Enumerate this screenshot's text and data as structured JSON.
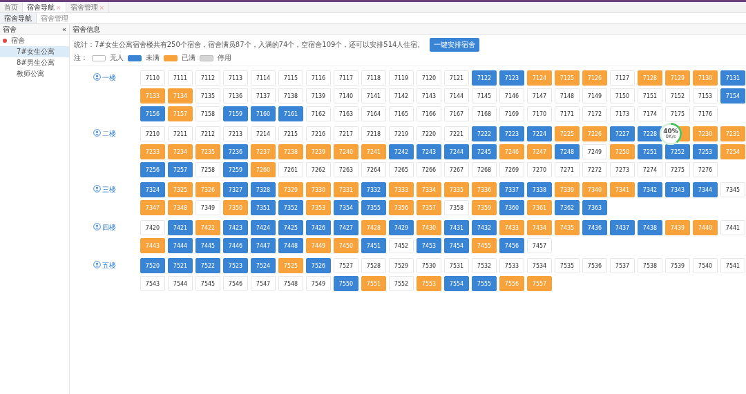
{
  "top_tabs": [
    {
      "label": "首页",
      "selected": false
    },
    {
      "label": "宿舍导航",
      "selected": true,
      "close": "×"
    },
    {
      "label": "宿舍管理",
      "selected": false,
      "close": "×"
    }
  ],
  "sub_tabs": [
    {
      "label": "宿舍导航",
      "selected": true
    },
    {
      "label": "宿舍管理",
      "selected": false
    }
  ],
  "sidebar": {
    "title": "宿舍",
    "collapse": "«",
    "tree": [
      {
        "label": "宿舍",
        "selected": false,
        "children": [
          {
            "label": "7#女生公寓",
            "selected": true
          },
          {
            "label": "8#男生公寓",
            "selected": false
          },
          {
            "label": "教师公寓",
            "selected": false
          }
        ]
      }
    ]
  },
  "main": {
    "title": "宿舍信息",
    "summary": "统计：7#女生公寓宿舍楼共有250个宿舍，宿舍满员87个，入满的74个，空宿舍109个，还可以安排514人住宿。",
    "action": "一键安排宿舍",
    "legend_label": "注：",
    "legend": [
      {
        "color": "#ffffff",
        "label": "无人"
      },
      {
        "color": "#3a84d6",
        "label": "未满"
      },
      {
        "color": "#f7a23a",
        "label": "已满"
      },
      {
        "color": "#d6d6d6",
        "label": "停用"
      }
    ],
    "floors": [
      {
        "label": "一楼",
        "rows": [
          [
            {
              "number": "7110",
              "color": "#ffffff"
            },
            {
              "number": "7111",
              "color": "#ffffff"
            },
            {
              "number": "7112",
              "color": "#ffffff"
            },
            {
              "number": "7113",
              "color": "#ffffff"
            },
            {
              "number": "7114",
              "color": "#ffffff"
            },
            {
              "number": "7115",
              "color": "#ffffff"
            },
            {
              "number": "7116",
              "color": "#ffffff"
            },
            {
              "number": "7117",
              "color": "#ffffff"
            },
            {
              "number": "7118",
              "color": "#ffffff"
            },
            {
              "number": "7119",
              "color": "#ffffff"
            },
            {
              "number": "7120",
              "color": "#ffffff"
            },
            {
              "number": "7121",
              "color": "#ffffff"
            },
            {
              "number": "7122",
              "color": "#3a84d6"
            },
            {
              "number": "7123",
              "color": "#3a84d6"
            },
            {
              "number": "7124",
              "color": "#f7a23a"
            },
            {
              "number": "7125",
              "color": "#f7a23a"
            },
            {
              "number": "7126",
              "color": "#f7a23a"
            },
            {
              "number": "7127",
              "color": "#ffffff"
            },
            {
              "number": "7128",
              "color": "#f7a23a"
            },
            {
              "number": "7129",
              "color": "#f7a23a"
            },
            {
              "number": "7130",
              "color": "#f7a23a"
            },
            {
              "number": "7131",
              "color": "#3a84d6"
            }
          ],
          [
            {
              "number": "7133",
              "color": "#f7a23a"
            },
            {
              "number": "7134",
              "color": "#f7a23a"
            },
            {
              "number": "7135",
              "color": "#ffffff"
            },
            {
              "number": "7136",
              "color": "#ffffff"
            },
            {
              "number": "7137",
              "color": "#ffffff"
            },
            {
              "number": "7138",
              "color": "#ffffff"
            },
            {
              "number": "7139",
              "color": "#ffffff"
            },
            {
              "number": "7140",
              "color": "#ffffff"
            },
            {
              "number": "7141",
              "color": "#ffffff"
            },
            {
              "number": "7142",
              "color": "#ffffff"
            },
            {
              "number": "7143",
              "color": "#ffffff"
            },
            {
              "number": "7144",
              "color": "#ffffff"
            },
            {
              "number": "7145",
              "color": "#ffffff"
            },
            {
              "number": "7146",
              "color": "#ffffff"
            },
            {
              "number": "7147",
              "color": "#ffffff"
            },
            {
              "number": "7148",
              "color": "#ffffff"
            },
            {
              "number": "7149",
              "color": "#ffffff"
            },
            {
              "number": "7150",
              "color": "#ffffff"
            },
            {
              "number": "7151",
              "color": "#ffffff"
            },
            {
              "number": "7152",
              "color": "#ffffff"
            },
            {
              "number": "7153",
              "color": "#ffffff"
            },
            {
              "number": "7154",
              "color": "#3a84d6"
            }
          ],
          [
            {
              "number": "7156",
              "color": "#3a84d6"
            },
            {
              "number": "7157",
              "color": "#f7a23a"
            },
            {
              "number": "7158",
              "color": "#ffffff"
            },
            {
              "number": "7159",
              "color": "#3a84d6"
            },
            {
              "number": "7160",
              "color": "#3a84d6"
            },
            {
              "number": "7161",
              "color": "#3a84d6"
            },
            {
              "number": "7162",
              "color": "#ffffff"
            },
            {
              "number": "7163",
              "color": "#ffffff"
            },
            {
              "number": "7164",
              "color": "#ffffff"
            },
            {
              "number": "7165",
              "color": "#ffffff"
            },
            {
              "number": "7166",
              "color": "#ffffff"
            },
            {
              "number": "7167",
              "color": "#ffffff"
            },
            {
              "number": "7168",
              "color": "#ffffff"
            },
            {
              "number": "7169",
              "color": "#ffffff"
            },
            {
              "number": "7170",
              "color": "#ffffff"
            },
            {
              "number": "7171",
              "color": "#ffffff"
            },
            {
              "number": "7172",
              "color": "#ffffff"
            },
            {
              "number": "7173",
              "color": "#ffffff"
            },
            {
              "number": "7174",
              "color": "#ffffff"
            },
            {
              "number": "7175",
              "color": "#ffffff"
            },
            {
              "number": "7176",
              "color": "#ffffff"
            }
          ]
        ]
      },
      {
        "label": "二楼",
        "rows": [
          [
            {
              "number": "7210",
              "color": "#ffffff"
            },
            {
              "number": "7211",
              "color": "#ffffff"
            },
            {
              "number": "7212",
              "color": "#ffffff"
            },
            {
              "number": "7213",
              "color": "#ffffff"
            },
            {
              "number": "7214",
              "color": "#ffffff"
            },
            {
              "number": "7215",
              "color": "#ffffff"
            },
            {
              "number": "7216",
              "color": "#ffffff"
            },
            {
              "number": "7217",
              "color": "#ffffff"
            },
            {
              "number": "7218",
              "color": "#ffffff"
            },
            {
              "number": "7219",
              "color": "#ffffff"
            },
            {
              "number": "7220",
              "color": "#ffffff"
            },
            {
              "number": "7221",
              "color": "#ffffff"
            },
            {
              "number": "7222",
              "color": "#3a84d6"
            },
            {
              "number": "7223",
              "color": "#3a84d6"
            },
            {
              "number": "7224",
              "color": "#3a84d6"
            },
            {
              "number": "7225",
              "color": "#f7a23a"
            },
            {
              "number": "7226",
              "color": "#f7a23a"
            },
            {
              "number": "7227",
              "color": "#3a84d6"
            },
            {
              "number": "7228",
              "color": "#3a84d6"
            },
            {
              "color": "#f7a23a"
            },
            {
              "number": "7230",
              "color": "#f7a23a"
            },
            {
              "number": "7231",
              "color": "#f7a23a"
            }
          ],
          [
            {
              "number": "7233",
              "color": "#f7a23a"
            },
            {
              "number": "7234",
              "color": "#f7a23a"
            },
            {
              "number": "7235",
              "color": "#f7a23a"
            },
            {
              "number": "7236",
              "color": "#3a84d6"
            },
            {
              "number": "7237",
              "color": "#f7a23a"
            },
            {
              "number": "7238",
              "color": "#f7a23a"
            },
            {
              "number": "7239",
              "color": "#f7a23a"
            },
            {
              "number": "7240",
              "color": "#f7a23a"
            },
            {
              "number": "7241",
              "color": "#f7a23a"
            },
            {
              "number": "7242",
              "color": "#3a84d6"
            },
            {
              "number": "7243",
              "color": "#3a84d6"
            },
            {
              "number": "7244",
              "color": "#3a84d6"
            },
            {
              "number": "7245",
              "color": "#3a84d6"
            },
            {
              "number": "7246",
              "color": "#f7a23a"
            },
            {
              "number": "7247",
              "color": "#f7a23a"
            },
            {
              "number": "7248",
              "color": "#3a84d6"
            },
            {
              "number": "7249",
              "color": "#ffffff"
            },
            {
              "number": "7250",
              "color": "#f7a23a"
            },
            {
              "number": "7251",
              "color": "#3a84d6"
            },
            {
              "number": "7252",
              "color": "#3a84d6"
            },
            {
              "number": "7253",
              "color": "#3a84d6"
            },
            {
              "number": "7254",
              "color": "#f7a23a"
            }
          ],
          [
            {
              "number": "7256",
              "color": "#3a84d6"
            },
            {
              "number": "7257",
              "color": "#3a84d6"
            },
            {
              "number": "7258",
              "color": "#ffffff"
            },
            {
              "number": "7259",
              "color": "#3a84d6"
            },
            {
              "number": "7260",
              "color": "#f7a23a"
            },
            {
              "number": "7261",
              "color": "#ffffff"
            },
            {
              "number": "7262",
              "color": "#ffffff"
            },
            {
              "number": "7263",
              "color": "#ffffff"
            },
            {
              "number": "7264",
              "color": "#ffffff"
            },
            {
              "number": "7265",
              "color": "#ffffff"
            },
            {
              "number": "7266",
              "color": "#ffffff"
            },
            {
              "number": "7267",
              "color": "#ffffff"
            },
            {
              "number": "7268",
              "color": "#ffffff"
            },
            {
              "number": "7269",
              "color": "#ffffff"
            },
            {
              "number": "7270",
              "color": "#ffffff"
            },
            {
              "number": "7271",
              "color": "#ffffff"
            },
            {
              "number": "7272",
              "color": "#ffffff"
            },
            {
              "number": "7273",
              "color": "#ffffff"
            },
            {
              "number": "7274",
              "color": "#ffffff"
            },
            {
              "number": "7275",
              "color": "#ffffff"
            },
            {
              "number": "7276",
              "color": "#ffffff"
            }
          ]
        ]
      },
      {
        "label": "三楼",
        "rows": [
          [
            {
              "number": "7324",
              "color": "#3a84d6"
            },
            {
              "number": "7325",
              "color": "#f7a23a"
            },
            {
              "number": "7326",
              "color": "#f7a23a"
            },
            {
              "number": "7327",
              "color": "#3a84d6"
            },
            {
              "number": "7328",
              "color": "#3a84d6"
            },
            {
              "number": "7329",
              "color": "#f7a23a"
            },
            {
              "number": "7330",
              "color": "#f7a23a"
            },
            {
              "number": "7331",
              "color": "#f7a23a"
            },
            {
              "number": "7332",
              "color": "#3a84d6"
            },
            {
              "number": "7333",
              "color": "#f7a23a"
            },
            {
              "number": "7334",
              "color": "#f7a23a"
            },
            {
              "number": "7335",
              "color": "#f7a23a"
            },
            {
              "number": "7336",
              "color": "#f7a23a"
            },
            {
              "number": "7337",
              "color": "#3a84d6"
            },
            {
              "number": "7338",
              "color": "#3a84d6"
            },
            {
              "number": "7339",
              "color": "#f7a23a"
            },
            {
              "number": "7340",
              "color": "#f7a23a"
            },
            {
              "number": "7341",
              "color": "#f7a23a"
            },
            {
              "number": "7342",
              "color": "#3a84d6"
            },
            {
              "number": "7343",
              "color": "#3a84d6"
            },
            {
              "number": "7344",
              "color": "#3a84d6"
            },
            {
              "number": "7345",
              "color": "#ffffff"
            }
          ],
          [
            {
              "number": "7347",
              "color": "#f7a23a"
            },
            {
              "number": "7348",
              "color": "#f7a23a"
            },
            {
              "number": "7349",
              "color": "#ffffff"
            },
            {
              "number": "7350",
              "color": "#f7a23a"
            },
            {
              "number": "7351",
              "color": "#3a84d6"
            },
            {
              "number": "7352",
              "color": "#3a84d6"
            },
            {
              "number": "7353",
              "color": "#f7a23a"
            },
            {
              "number": "7354",
              "color": "#3a84d6"
            },
            {
              "number": "7355",
              "color": "#3a84d6"
            },
            {
              "number": "7356",
              "color": "#f7a23a"
            },
            {
              "number": "7357",
              "color": "#f7a23a"
            },
            {
              "number": "7358",
              "color": "#ffffff"
            },
            {
              "number": "7359",
              "color": "#f7a23a"
            },
            {
              "number": "7360",
              "color": "#3a84d6"
            },
            {
              "number": "7361",
              "color": "#f7a23a"
            },
            {
              "number": "7362",
              "color": "#3a84d6"
            },
            {
              "number": "7363",
              "color": "#3a84d6"
            }
          ]
        ]
      },
      {
        "label": "四楼",
        "rows": [
          [
            {
              "number": "7420",
              "color": "#ffffff"
            },
            {
              "number": "7421",
              "color": "#3a84d6"
            },
            {
              "number": "7422",
              "color": "#f7a23a"
            },
            {
              "number": "7423",
              "color": "#3a84d6"
            },
            {
              "number": "7424",
              "color": "#3a84d6"
            },
            {
              "number": "7425",
              "color": "#3a84d6"
            },
            {
              "number": "7426",
              "color": "#3a84d6"
            },
            {
              "number": "7427",
              "color": "#3a84d6"
            },
            {
              "number": "7428",
              "color": "#f7a23a"
            },
            {
              "number": "7429",
              "color": "#3a84d6"
            },
            {
              "number": "7430",
              "color": "#f7a23a"
            },
            {
              "number": "7431",
              "color": "#3a84d6"
            },
            {
              "number": "7432",
              "color": "#3a84d6"
            },
            {
              "number": "7433",
              "color": "#f7a23a"
            },
            {
              "number": "7434",
              "color": "#f7a23a"
            },
            {
              "number": "7435",
              "color": "#f7a23a"
            },
            {
              "number": "7436",
              "color": "#3a84d6"
            },
            {
              "number": "7437",
              "color": "#3a84d6"
            },
            {
              "number": "7438",
              "color": "#3a84d6"
            },
            {
              "number": "7439",
              "color": "#f7a23a"
            },
            {
              "number": "7440",
              "color": "#f7a23a"
            },
            {
              "number": "7441",
              "color": "#ffffff"
            }
          ],
          [
            {
              "number": "7443",
              "color": "#f7a23a"
            },
            {
              "number": "7444",
              "color": "#3a84d6"
            },
            {
              "number": "7445",
              "color": "#3a84d6"
            },
            {
              "number": "7446",
              "color": "#3a84d6"
            },
            {
              "number": "7447",
              "color": "#3a84d6"
            },
            {
              "number": "7448",
              "color": "#3a84d6"
            },
            {
              "number": "7449",
              "color": "#f7a23a"
            },
            {
              "number": "7450",
              "color": "#f7a23a"
            },
            {
              "number": "7451",
              "color": "#3a84d6"
            },
            {
              "number": "7452",
              "color": "#ffffff"
            },
            {
              "number": "7453",
              "color": "#3a84d6"
            },
            {
              "number": "7454",
              "color": "#3a84d6"
            },
            {
              "number": "7455",
              "color": "#f7a23a"
            },
            {
              "number": "7456",
              "color": "#3a84d6"
            },
            {
              "number": "7457",
              "color": "#ffffff"
            }
          ]
        ]
      },
      {
        "label": "五楼",
        "rows": [
          [
            {
              "number": "7520",
              "color": "#3a84d6"
            },
            {
              "number": "7521",
              "color": "#3a84d6"
            },
            {
              "number": "7522",
              "color": "#3a84d6"
            },
            {
              "number": "7523",
              "color": "#3a84d6"
            },
            {
              "number": "7524",
              "color": "#3a84d6"
            },
            {
              "number": "7525",
              "color": "#f7a23a"
            },
            {
              "number": "7526",
              "color": "#3a84d6"
            },
            {
              "number": "7527",
              "color": "#ffffff"
            },
            {
              "number": "7528",
              "color": "#ffffff"
            },
            {
              "number": "7529",
              "color": "#ffffff"
            },
            {
              "number": "7530",
              "color": "#ffffff"
            },
            {
              "number": "7531",
              "color": "#ffffff"
            },
            {
              "number": "7532",
              "color": "#ffffff"
            },
            {
              "number": "7533",
              "color": "#ffffff"
            },
            {
              "number": "7534",
              "color": "#ffffff"
            },
            {
              "number": "7535",
              "color": "#ffffff"
            },
            {
              "number": "7536",
              "color": "#ffffff"
            },
            {
              "number": "7537",
              "color": "#ffffff"
            },
            {
              "number": "7538",
              "color": "#ffffff"
            },
            {
              "number": "7539",
              "color": "#ffffff"
            },
            {
              "number": "7540",
              "color": "#ffffff"
            },
            {
              "number": "7541",
              "color": "#ffffff"
            }
          ],
          [
            {
              "number": "7543",
              "color": "#ffffff"
            },
            {
              "number": "7544",
              "color": "#ffffff"
            },
            {
              "number": "7545",
              "color": "#ffffff"
            },
            {
              "number": "7546",
              "color": "#ffffff"
            },
            {
              "number": "7547",
              "color": "#ffffff"
            },
            {
              "number": "7548",
              "color": "#ffffff"
            },
            {
              "number": "7549",
              "color": "#ffffff"
            },
            {
              "number": "7550",
              "color": "#3a84d6"
            },
            {
              "number": "7551",
              "color": "#f7a23a"
            },
            {
              "number": "7552",
              "color": "#ffffff"
            },
            {
              "number": "7553",
              "color": "#f7a23a"
            },
            {
              "number": "7554",
              "color": "#3a84d6"
            },
            {
              "number": "7555",
              "color": "#3a84d6"
            },
            {
              "number": "7556",
              "color": "#f7a23a"
            },
            {
              "number": "7557",
              "color": "#f7a23a"
            }
          ]
        ]
      }
    ]
  },
  "speed_widget": {
    "percent": "40%",
    "level": 0.4,
    "speed": "0K/s"
  }
}
